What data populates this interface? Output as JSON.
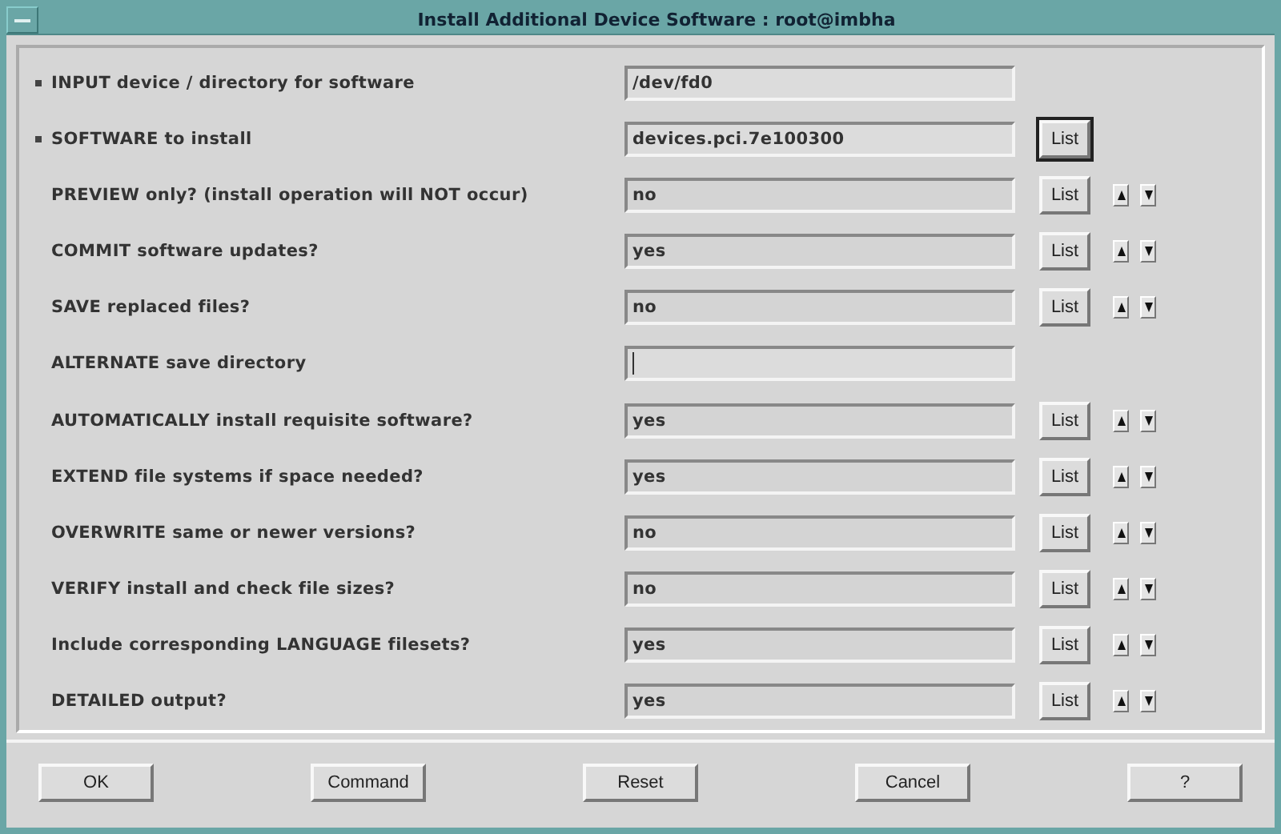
{
  "window": {
    "title": "Install Additional Device Software : root@imbha"
  },
  "rows": [
    {
      "kind": "entry",
      "required": true,
      "label": "INPUT device / directory for software",
      "value": "/dev/fd0"
    },
    {
      "kind": "listed",
      "required": true,
      "label": "SOFTWARE to install",
      "value": "devices.pci.7e100300",
      "list": {
        "label": "List",
        "focused": true
      }
    },
    {
      "kind": "cycle",
      "required": false,
      "label": "PREVIEW only? (install operation will NOT occur)",
      "value": "no",
      "list": {
        "label": "List",
        "focused": false
      }
    },
    {
      "kind": "cycle",
      "required": false,
      "label": "COMMIT software updates?",
      "value": "yes",
      "list": {
        "label": "List",
        "focused": false
      }
    },
    {
      "kind": "cycle",
      "required": false,
      "label": "SAVE replaced files?",
      "value": "no",
      "list": {
        "label": "List",
        "focused": false
      }
    },
    {
      "kind": "entry",
      "required": false,
      "label": "ALTERNATE save directory",
      "value": ""
    },
    {
      "kind": "cycle",
      "required": false,
      "label": "AUTOMATICALLY install requisite software?",
      "value": "yes",
      "list": {
        "label": "List",
        "focused": false
      }
    },
    {
      "kind": "cycle",
      "required": false,
      "label": "EXTEND file systems if space needed?",
      "value": "yes",
      "list": {
        "label": "List",
        "focused": false
      }
    },
    {
      "kind": "cycle",
      "required": false,
      "label": "OVERWRITE same or newer versions?",
      "value": "no",
      "list": {
        "label": "List",
        "focused": false
      }
    },
    {
      "kind": "cycle",
      "required": false,
      "label": "VERIFY install and check file sizes?",
      "value": "no",
      "list": {
        "label": "List",
        "focused": false
      }
    },
    {
      "kind": "cycle",
      "required": false,
      "label": "Include corresponding LANGUAGE filesets?",
      "value": "yes",
      "list": {
        "label": "List",
        "focused": false
      }
    },
    {
      "kind": "cycle",
      "required": false,
      "label": "DETAILED output?",
      "value": "yes",
      "list": {
        "label": "List",
        "focused": false
      }
    }
  ],
  "buttons": [
    "OK",
    "Command",
    "Reset",
    "Cancel",
    "?"
  ]
}
